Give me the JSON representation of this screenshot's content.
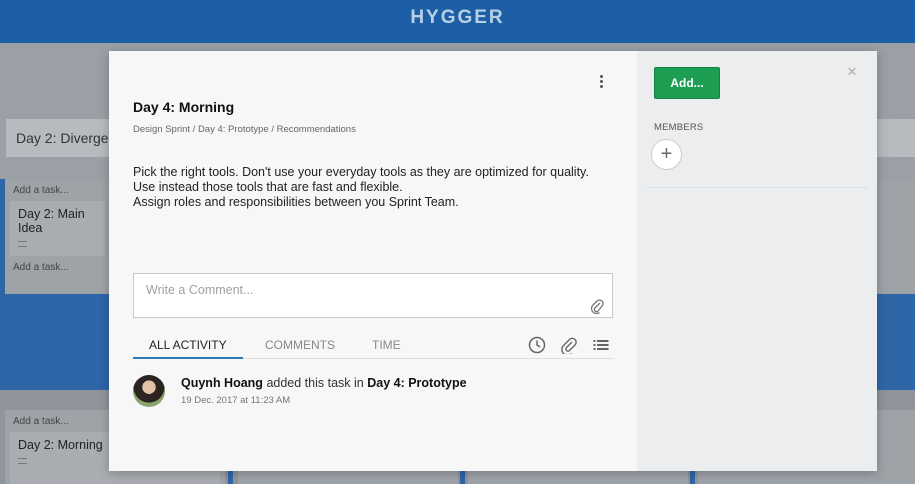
{
  "app": {
    "logo": "HYGGER"
  },
  "board": {
    "lanes": [
      {
        "title": "Day 2: Diverge"
      }
    ],
    "add_task_label": "Add a task...",
    "cards": [
      {
        "title": "Day 2: Main Idea"
      },
      {
        "title": "Day 2: Morning"
      }
    ]
  },
  "modal": {
    "title": "Day 4: Morning",
    "breadcrumb": "Design Sprint / Day 4: Prototype / Recommendations",
    "description": [
      "Pick the right tools. Don't use your everyday tools as they are optimized for quality.",
      "Use instead those tools that are fast and flexible.",
      "Assign roles and responsibilities between you Sprint Team."
    ],
    "comment": {
      "placeholder": "Write a Comment...",
      "value": ""
    },
    "tabs": [
      {
        "label": "ALL ACTIVITY",
        "active": true
      },
      {
        "label": "COMMENTS",
        "active": false
      },
      {
        "label": "TIME",
        "active": false
      }
    ],
    "tab_icons": [
      "clock-icon",
      "paperclip-icon",
      "list-icon"
    ],
    "activity": [
      {
        "user": "Quynh Hoang",
        "action": "added this task in",
        "target": "Day 4: Prototype",
        "time": "19 Dec. 2017 at 11:23 AM"
      }
    ],
    "sidebar": {
      "add_button": "Add...",
      "members_label": "MEMBERS",
      "add_member_symbol": "+",
      "close_symbol": "×"
    }
  },
  "colors": {
    "header": "#1c5fa6",
    "accent_tab": "#2f7ab9",
    "add_button": "#1e9e52"
  }
}
